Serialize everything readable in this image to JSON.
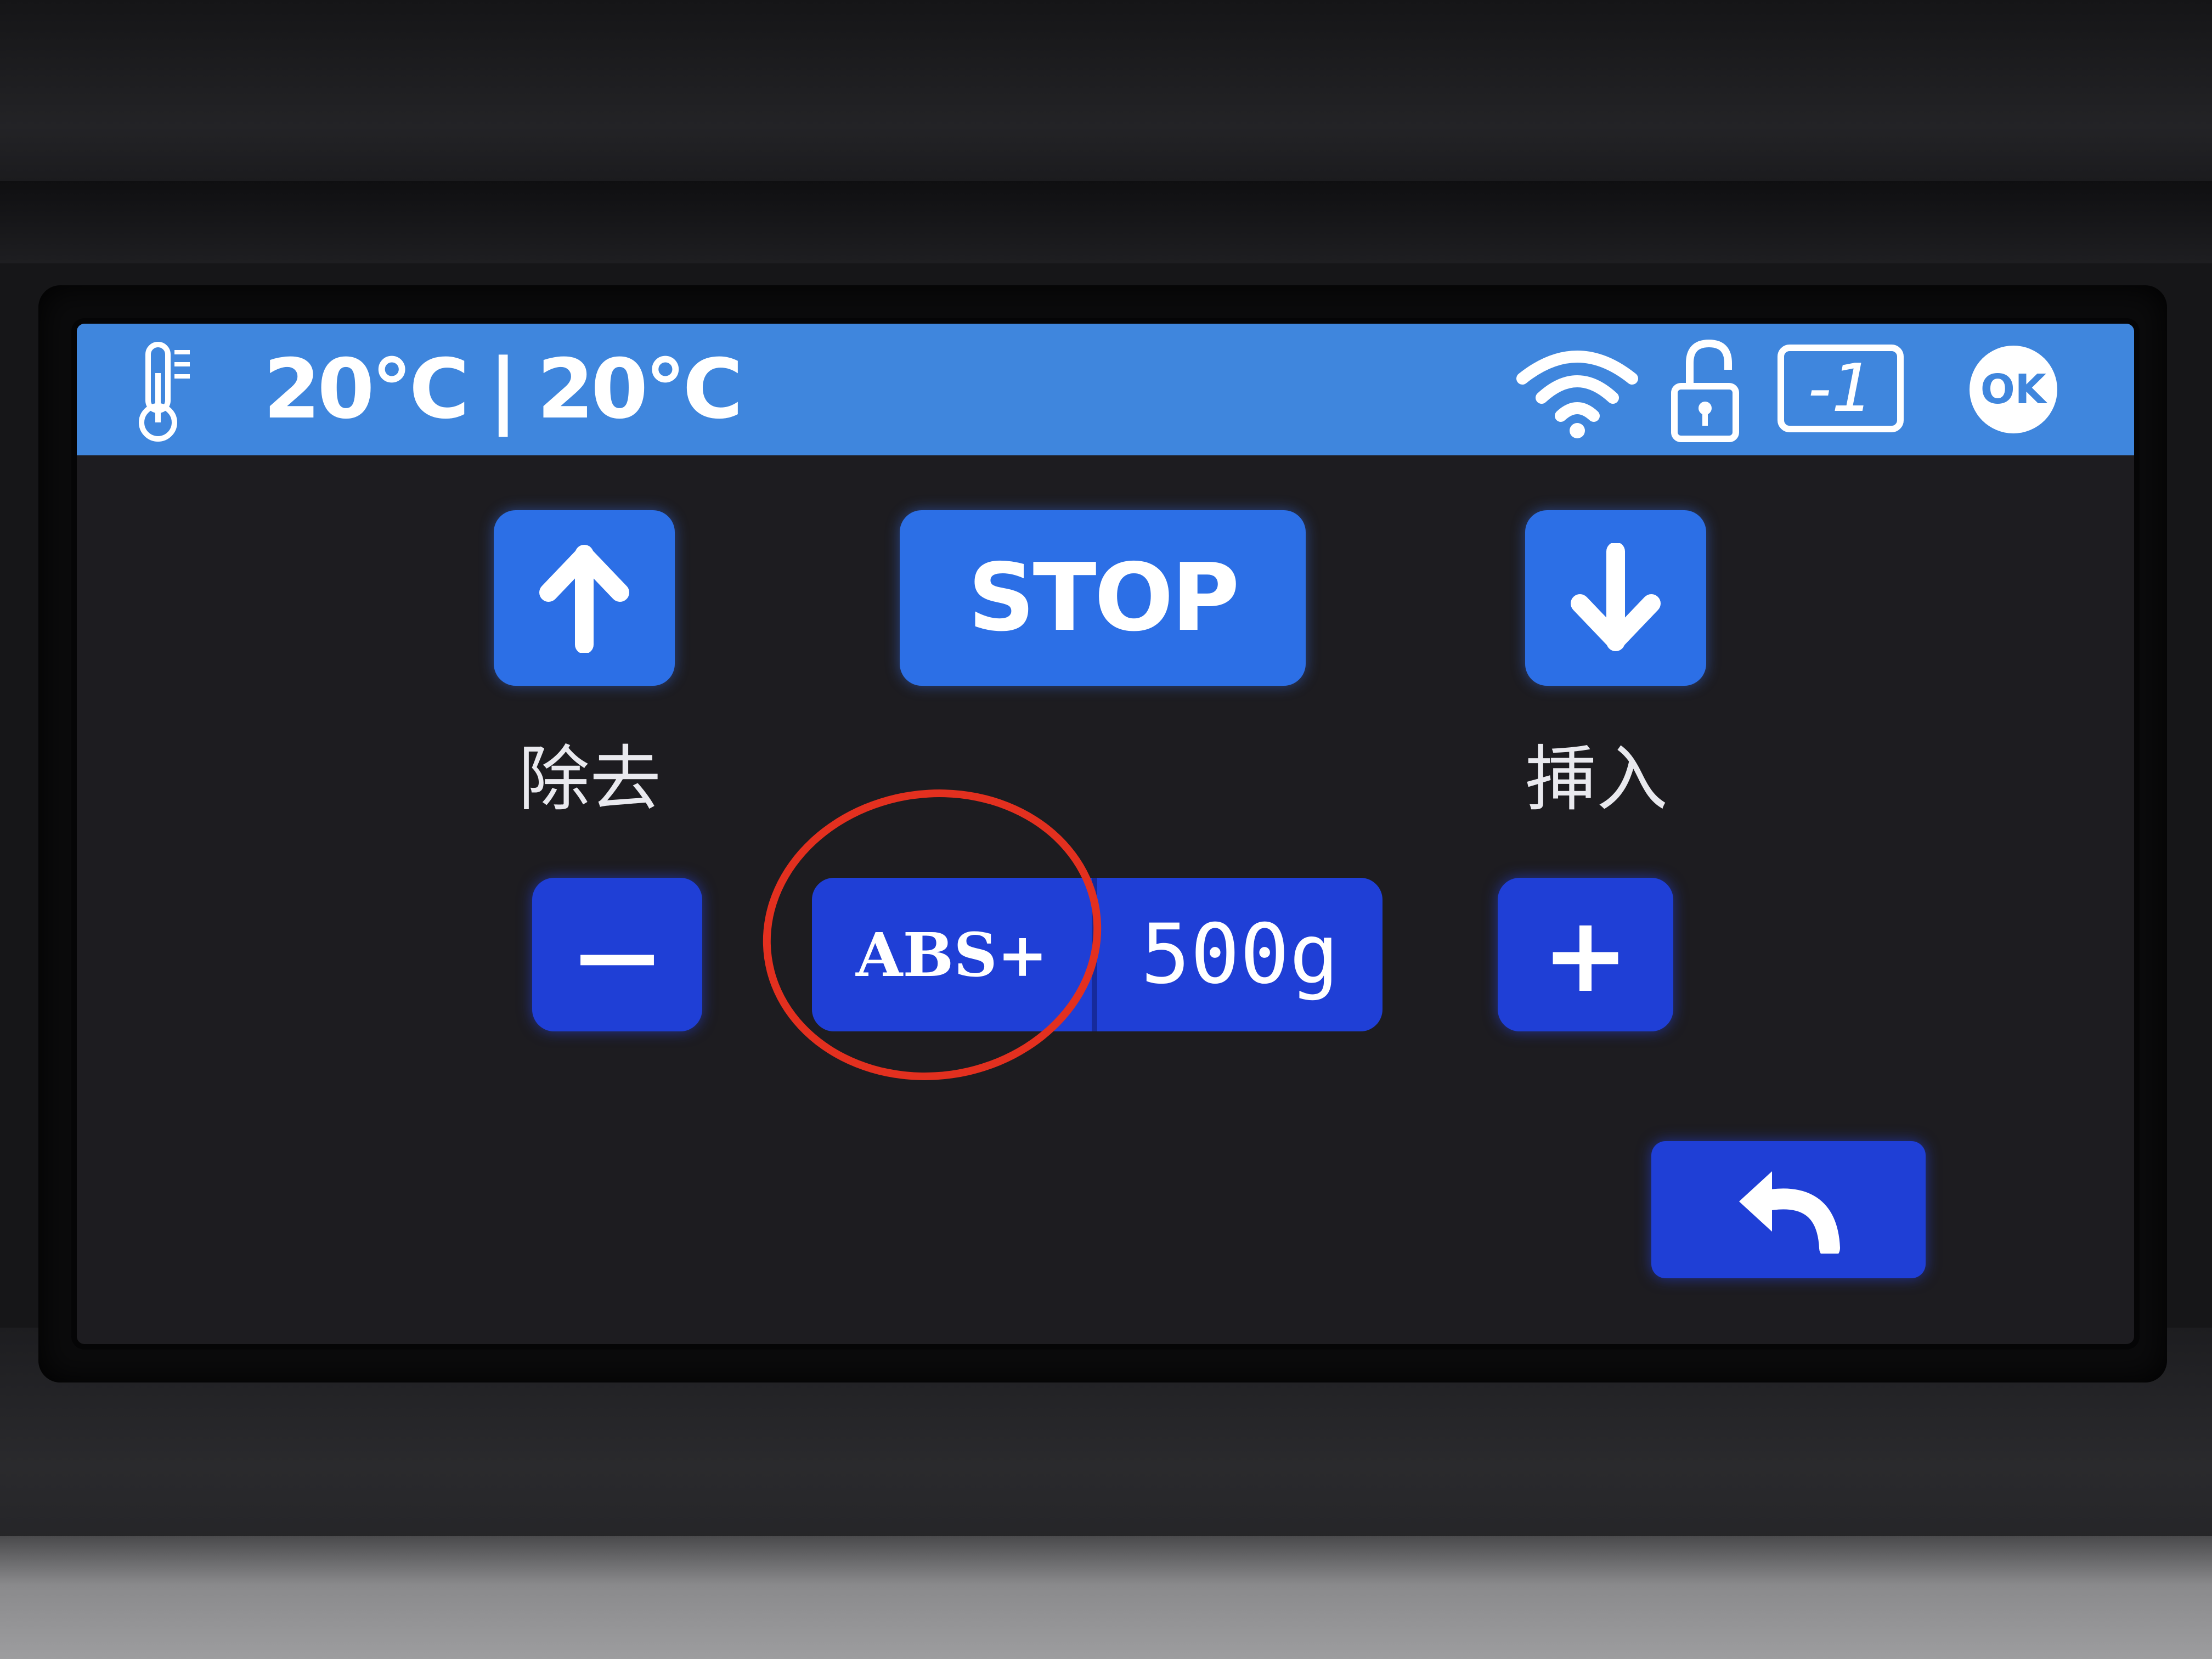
{
  "status_bar": {
    "temp_1": "20°C",
    "separator": "|",
    "temp_2": "20°C",
    "counter": "-1",
    "ok_label": "OK",
    "icons": [
      "thermometer-icon",
      "wifi-icon",
      "unlock-icon",
      "ok-icon"
    ]
  },
  "controls": {
    "stop_label": "STOP",
    "remove_label": "除去",
    "insert_label": "挿入",
    "minus_label": "—",
    "plus_label": "+",
    "material_label": "ABS+",
    "weight_label": "500g"
  },
  "colors": {
    "status_bar": "#3f86dd",
    "button_light": "#2c6fe6",
    "button_dark": "#1f3fd6",
    "annotation": "#e3301f"
  }
}
